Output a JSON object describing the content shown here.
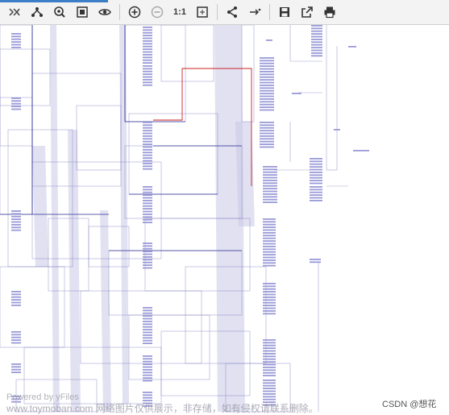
{
  "toolbar": {
    "progress_percent": 24,
    "buttons": [
      {
        "name": "collapse-panel-button",
        "icon": "double-chevron-icon"
      },
      {
        "name": "layout-button",
        "icon": "hierarchy-icon"
      },
      {
        "name": "navigate-button",
        "icon": "target-icon"
      },
      {
        "name": "overview-button",
        "icon": "overview-icon"
      },
      {
        "name": "visibility-button",
        "icon": "eye-icon"
      },
      {
        "name": "zoom-in-button",
        "icon": "plus-circle-icon"
      },
      {
        "name": "zoom-out-button",
        "icon": "minus-circle-icon"
      },
      {
        "name": "actual-size-button",
        "label": "1:1"
      },
      {
        "name": "fit-content-button",
        "icon": "fit-icon"
      },
      {
        "name": "share-button",
        "icon": "share-icon"
      },
      {
        "name": "edge-button",
        "icon": "edge-icon"
      },
      {
        "name": "save-button",
        "icon": "save-icon"
      },
      {
        "name": "export-button",
        "icon": "export-icon"
      },
      {
        "name": "print-button",
        "icon": "print-icon"
      }
    ],
    "actual_size_label": "1:1"
  },
  "watermarks": {
    "powered_by": "Powered by yFiles",
    "source": "www.toymoban.com 网络图片仅供展示，非存储，如有侵权请联系删除。",
    "csdn": "CSDN @想花"
  },
  "colors": {
    "node": "#9a9ad8",
    "edge": "#8080c0",
    "bundle": "#c8c8e6",
    "highlight": "#cc2222",
    "accent": "#3d7fc6"
  }
}
